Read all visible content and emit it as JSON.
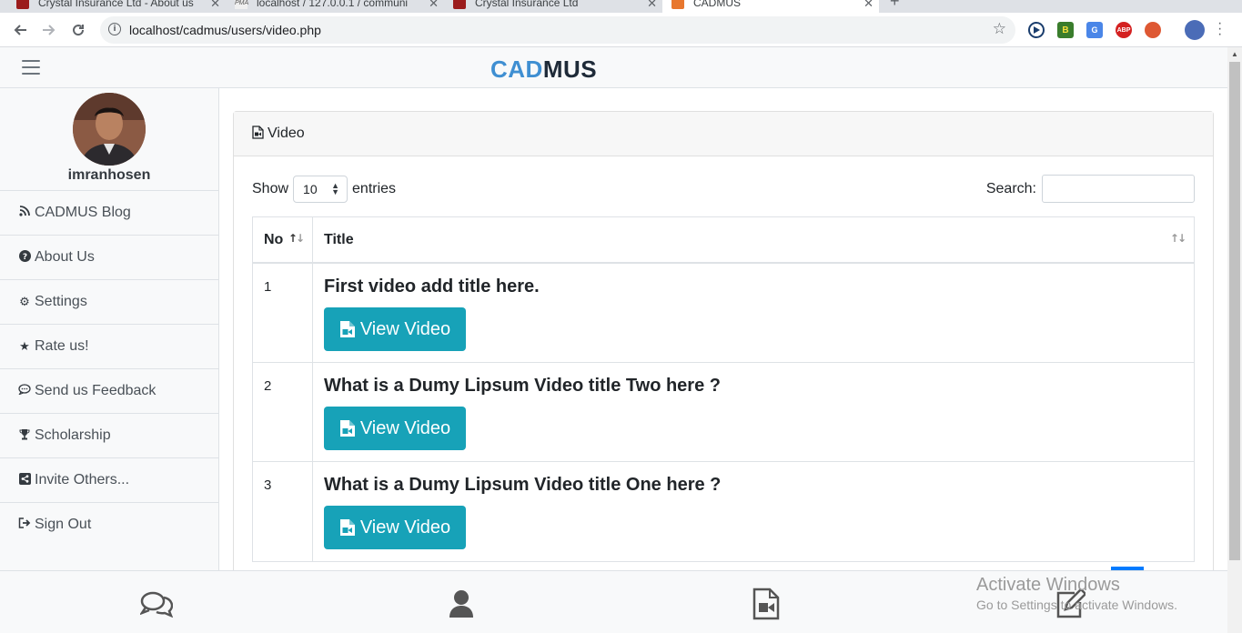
{
  "browser": {
    "tabs": [
      {
        "title": "Crystal Insurance Ltd - About us",
        "active": false
      },
      {
        "title": "localhost / 127.0.0.1 / communi",
        "active": false
      },
      {
        "title": "Crystal Insurance Ltd",
        "active": false
      },
      {
        "title": "CADMUS",
        "active": true
      }
    ],
    "new_tab": "+",
    "url": "localhost/cadmus/users/video.php",
    "extensions": [
      "play-extension",
      "b-extension",
      "translate-extension",
      "adblock-extension",
      "duckduckgo-extension"
    ],
    "adblock_label": "ABP"
  },
  "header": {
    "brand_part1": "CAD",
    "brand_part2": "MUS"
  },
  "sidebar": {
    "username": "imranhosen",
    "items": [
      {
        "label": "CADMUS Blog",
        "icon": "rss-icon",
        "glyph": "☷"
      },
      {
        "label": "About Us",
        "icon": "question-circle-icon",
        "glyph": "?"
      },
      {
        "label": "Settings",
        "icon": "cogs-icon",
        "glyph": "⚙"
      },
      {
        "label": "Rate us!",
        "icon": "star-icon",
        "glyph": "★"
      },
      {
        "label": "Send us Feedback",
        "icon": "comment-icon",
        "glyph": "◯"
      },
      {
        "label": "Scholarship",
        "icon": "trophy-icon",
        "glyph": "❂"
      },
      {
        "label": "Invite Others...",
        "icon": "share-square-icon",
        "glyph": "↪"
      },
      {
        "label": "Sign Out",
        "icon": "sign-out-icon",
        "glyph": "⇥"
      }
    ]
  },
  "main": {
    "card_title": "Video",
    "show_label": "Show",
    "entries_value": "10",
    "entries_label": "entries",
    "search_label": "Search:",
    "search_value": "",
    "columns": [
      "No",
      "Title"
    ],
    "rows": [
      {
        "no": "1",
        "title": "First video add title here.",
        "button": "View Video"
      },
      {
        "no": "2",
        "title": "What is a Dumy Lipsum Video title Two here ?",
        "button": "View Video"
      },
      {
        "no": "3",
        "title": "What is a Dumy Lipsum Video title One here ?",
        "button": "View Video"
      }
    ]
  },
  "bottom_nav": [
    {
      "icon": "comments-icon"
    },
    {
      "icon": "user-icon"
    },
    {
      "icon": "video-file-icon"
    },
    {
      "icon": "edit-icon"
    }
  ],
  "watermark": {
    "line1": "Activate Windows",
    "line2": "Go to Settings to activate Windows."
  },
  "colors": {
    "accent": "#17a2b8",
    "brand_blue": "#3f8fd2",
    "brand_dark": "#1e2a38"
  }
}
